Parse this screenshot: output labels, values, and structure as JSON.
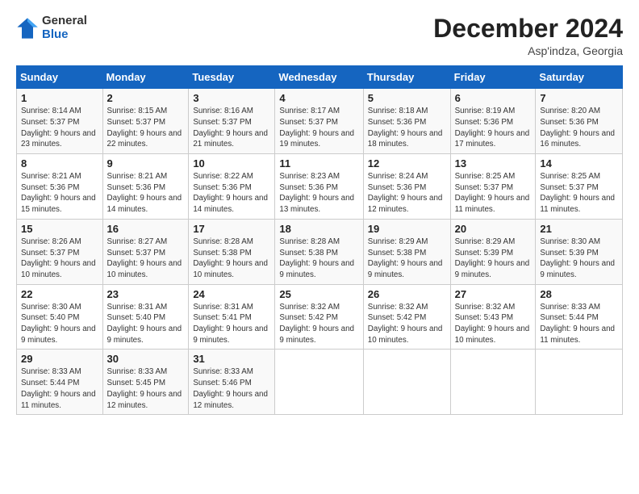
{
  "logo": {
    "line1": "General",
    "line2": "Blue"
  },
  "header": {
    "month": "December 2024",
    "location": "Asp'indza, Georgia"
  },
  "days_of_week": [
    "Sunday",
    "Monday",
    "Tuesday",
    "Wednesday",
    "Thursday",
    "Friday",
    "Saturday"
  ],
  "weeks": [
    [
      {
        "day": "1",
        "sunrise": "8:14 AM",
        "sunset": "5:37 PM",
        "daylight": "9 hours and 23 minutes."
      },
      {
        "day": "2",
        "sunrise": "8:15 AM",
        "sunset": "5:37 PM",
        "daylight": "9 hours and 22 minutes."
      },
      {
        "day": "3",
        "sunrise": "8:16 AM",
        "sunset": "5:37 PM",
        "daylight": "9 hours and 21 minutes."
      },
      {
        "day": "4",
        "sunrise": "8:17 AM",
        "sunset": "5:37 PM",
        "daylight": "9 hours and 19 minutes."
      },
      {
        "day": "5",
        "sunrise": "8:18 AM",
        "sunset": "5:36 PM",
        "daylight": "9 hours and 18 minutes."
      },
      {
        "day": "6",
        "sunrise": "8:19 AM",
        "sunset": "5:36 PM",
        "daylight": "9 hours and 17 minutes."
      },
      {
        "day": "7",
        "sunrise": "8:20 AM",
        "sunset": "5:36 PM",
        "daylight": "9 hours and 16 minutes."
      }
    ],
    [
      {
        "day": "8",
        "sunrise": "8:21 AM",
        "sunset": "5:36 PM",
        "daylight": "9 hours and 15 minutes."
      },
      {
        "day": "9",
        "sunrise": "8:21 AM",
        "sunset": "5:36 PM",
        "daylight": "9 hours and 14 minutes."
      },
      {
        "day": "10",
        "sunrise": "8:22 AM",
        "sunset": "5:36 PM",
        "daylight": "9 hours and 14 minutes."
      },
      {
        "day": "11",
        "sunrise": "8:23 AM",
        "sunset": "5:36 PM",
        "daylight": "9 hours and 13 minutes."
      },
      {
        "day": "12",
        "sunrise": "8:24 AM",
        "sunset": "5:36 PM",
        "daylight": "9 hours and 12 minutes."
      },
      {
        "day": "13",
        "sunrise": "8:25 AM",
        "sunset": "5:37 PM",
        "daylight": "9 hours and 11 minutes."
      },
      {
        "day": "14",
        "sunrise": "8:25 AM",
        "sunset": "5:37 PM",
        "daylight": "9 hours and 11 minutes."
      }
    ],
    [
      {
        "day": "15",
        "sunrise": "8:26 AM",
        "sunset": "5:37 PM",
        "daylight": "9 hours and 10 minutes."
      },
      {
        "day": "16",
        "sunrise": "8:27 AM",
        "sunset": "5:37 PM",
        "daylight": "9 hours and 10 minutes."
      },
      {
        "day": "17",
        "sunrise": "8:28 AM",
        "sunset": "5:38 PM",
        "daylight": "9 hours and 10 minutes."
      },
      {
        "day": "18",
        "sunrise": "8:28 AM",
        "sunset": "5:38 PM",
        "daylight": "9 hours and 9 minutes."
      },
      {
        "day": "19",
        "sunrise": "8:29 AM",
        "sunset": "5:38 PM",
        "daylight": "9 hours and 9 minutes."
      },
      {
        "day": "20",
        "sunrise": "8:29 AM",
        "sunset": "5:39 PM",
        "daylight": "9 hours and 9 minutes."
      },
      {
        "day": "21",
        "sunrise": "8:30 AM",
        "sunset": "5:39 PM",
        "daylight": "9 hours and 9 minutes."
      }
    ],
    [
      {
        "day": "22",
        "sunrise": "8:30 AM",
        "sunset": "5:40 PM",
        "daylight": "9 hours and 9 minutes."
      },
      {
        "day": "23",
        "sunrise": "8:31 AM",
        "sunset": "5:40 PM",
        "daylight": "9 hours and 9 minutes."
      },
      {
        "day": "24",
        "sunrise": "8:31 AM",
        "sunset": "5:41 PM",
        "daylight": "9 hours and 9 minutes."
      },
      {
        "day": "25",
        "sunrise": "8:32 AM",
        "sunset": "5:42 PM",
        "daylight": "9 hours and 9 minutes."
      },
      {
        "day": "26",
        "sunrise": "8:32 AM",
        "sunset": "5:42 PM",
        "daylight": "9 hours and 10 minutes."
      },
      {
        "day": "27",
        "sunrise": "8:32 AM",
        "sunset": "5:43 PM",
        "daylight": "9 hours and 10 minutes."
      },
      {
        "day": "28",
        "sunrise": "8:33 AM",
        "sunset": "5:44 PM",
        "daylight": "9 hours and 11 minutes."
      }
    ],
    [
      {
        "day": "29",
        "sunrise": "8:33 AM",
        "sunset": "5:44 PM",
        "daylight": "9 hours and 11 minutes."
      },
      {
        "day": "30",
        "sunrise": "8:33 AM",
        "sunset": "5:45 PM",
        "daylight": "9 hours and 12 minutes."
      },
      {
        "day": "31",
        "sunrise": "8:33 AM",
        "sunset": "5:46 PM",
        "daylight": "9 hours and 12 minutes."
      },
      null,
      null,
      null,
      null
    ]
  ]
}
